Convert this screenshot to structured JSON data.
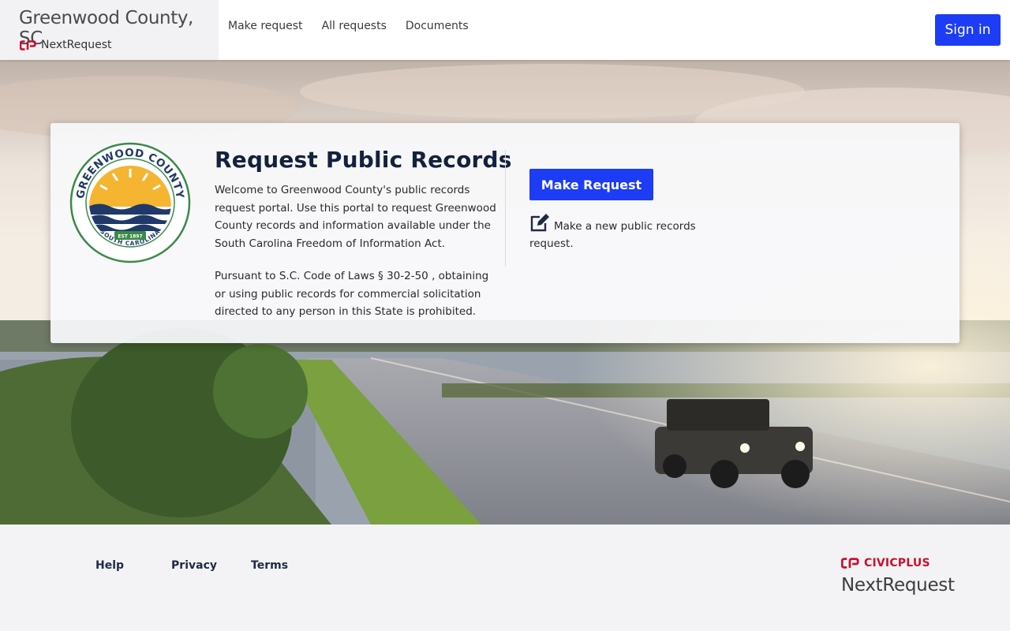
{
  "header": {
    "brand_title": "Greenwood County, SC",
    "brand_sub": "NextRequest",
    "nav": [
      "Make request",
      "All requests",
      "Documents"
    ],
    "signin_label": "Sign in"
  },
  "card": {
    "title": "Request Public Records",
    "para1": "Welcome to Greenwood County's public records request portal. Use this portal to request Greenwood County records and information available under the South Carolina Freedom of Information Act.",
    "para2": "Pursuant to S.C. Code of Laws § 30-2-50 , obtaining or using public records for commercial solicitation directed to any person in this State is prohibited.",
    "button_label": "Make Request",
    "action_text": "Make a new public records request.",
    "seal": {
      "top_text": "GREENWOOD COUNTY",
      "bottom_text": "SOUTH CAROLINA",
      "est": "EST 1897"
    }
  },
  "footer": {
    "links": [
      "Help",
      "Privacy",
      "Terms"
    ],
    "civic_label": "CIVICPLUS",
    "nextrequest_label": "NextRequest"
  },
  "colors": {
    "accent": "#1d3cf5",
    "title": "#14213d",
    "civic_red": "#c8102e",
    "seal_green": "#3a8a4a",
    "seal_navy": "#1f3a68",
    "seal_sun": "#f5b530"
  },
  "icons": [
    "cp-logo-icon",
    "edit-icon"
  ]
}
